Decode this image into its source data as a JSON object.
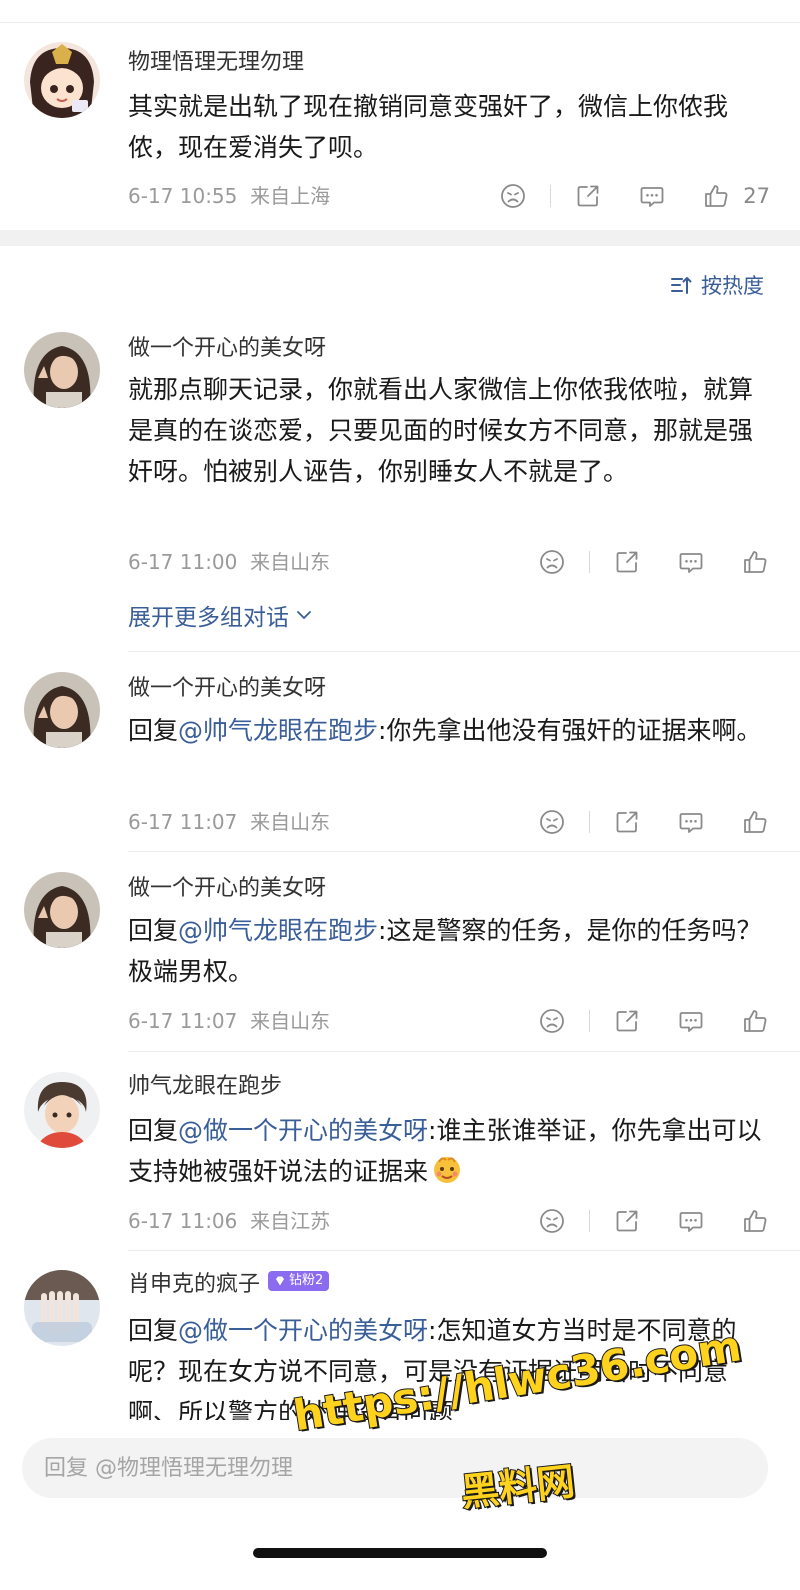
{
  "comments": [
    {
      "username": "物理悟理无理勿理",
      "text": "其实就是出轨了现在撤销同意变强奸了，微信上你侬我侬，现在爱消失了呗。",
      "time": "6-17 10:55",
      "location": "来自上海",
      "likes": "27"
    },
    {
      "username": "做一个开心的美女呀",
      "text": "就那点聊天记录，你就看出人家微信上你侬我侬啦，就算是真的在谈恋爱，只要见面的时候女方不同意，那就是强奸呀。怕被别人诬告，你别睡女人不就是了。",
      "time": "6-17 11:00",
      "location": "来自山东"
    },
    {
      "username": "做一个开心的美女呀",
      "reply_prefix": "回复",
      "mention": "@帅气龙眼在跑步",
      "text": ":你先拿出他没有强奸的证据来啊。",
      "time": "6-17 11:07",
      "location": "来自山东"
    },
    {
      "username": "做一个开心的美女呀",
      "reply_prefix": "回复",
      "mention": "@帅气龙眼在跑步",
      "text": ":这是警察的任务，是你的任务吗？极端男权。",
      "time": "6-17 11:07",
      "location": "来自山东"
    },
    {
      "username": "帅气龙眼在跑步",
      "reply_prefix": "回复",
      "mention": "@做一个开心的美女呀",
      "text": ":谁主张谁举证，你先拿出可以支持她被强奸说法的证据来",
      "time": "6-17 11:06",
      "location": "来自江苏"
    },
    {
      "username": "肖申克的疯子",
      "badge": "钻粉2",
      "reply_prefix": "回复",
      "mention": "@做一个开心的美女呀",
      "text": ":怎知道女方当时是不同意的呢？现在女方说不同意，可是没有证据证明当时不同意啊、所以警方的处理没有问题"
    }
  ],
  "sort_label": "按热度",
  "expand_label": "展开更多组对话",
  "reply_placeholder": "回复 @物理悟理无理勿理",
  "watermark": {
    "url": "https://hlwc36.com",
    "site": "黑料网"
  },
  "colors": {
    "link": "#3a5e98",
    "meta": "#9a9a9a",
    "badge": "#8b6cf0",
    "watermark": "#ffd21e"
  },
  "icons": [
    "dislike-face-icon",
    "share-icon",
    "comment-icon",
    "like-thumb-icon",
    "sort-icon",
    "chevron-down-icon",
    "diamond-icon",
    "emoji-icon"
  ]
}
